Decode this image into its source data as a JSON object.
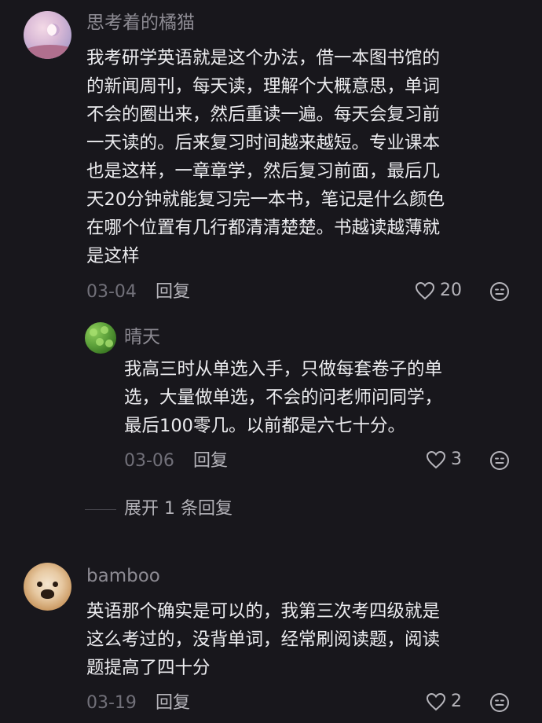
{
  "comments": [
    {
      "username": "思考着的橘猫",
      "text": "我考研学英语就是这个办法，借一本图书馆的\n的新闻周刊，每天读，理解个大概意思，单词\n不会的圈出来，然后重读一遍。每天会复习前\n一天读的。后来复习时间越来越短。专业课本\n也是这样，一章章学，然后复习前面，最后几\n天20分钟就能复习完一本书，笔记是什么颜色\n在哪个位置有几行都清清楚楚。书越读越薄就\n是这样",
      "date": "03-04",
      "reply_label": "回复",
      "likes": "20",
      "reply": {
        "username": "晴天",
        "text": "我高三时从单选入手，只做每套卷子的单\n选，大量做单选，不会的问老师问同学，\n最后100零几。以前都是六七十分。",
        "date": "03-06",
        "reply_label": "回复",
        "likes": "3"
      },
      "expand_label": "展开 1 条回复"
    },
    {
      "username": "bamboo",
      "text": "英语那个确实是可以的，我第三次考四级就是\n这么考过的，没背单词，经常刷阅读题，阅读\n题提高了四十分",
      "date": "03-19",
      "reply_label": "回复",
      "likes": "2"
    }
  ],
  "icons": {
    "like": "heart-outline-icon",
    "more": "emoji-face-icon"
  },
  "colors": {
    "background": "#18171c",
    "text": "#ececef",
    "muted": "#8c8a92"
  }
}
